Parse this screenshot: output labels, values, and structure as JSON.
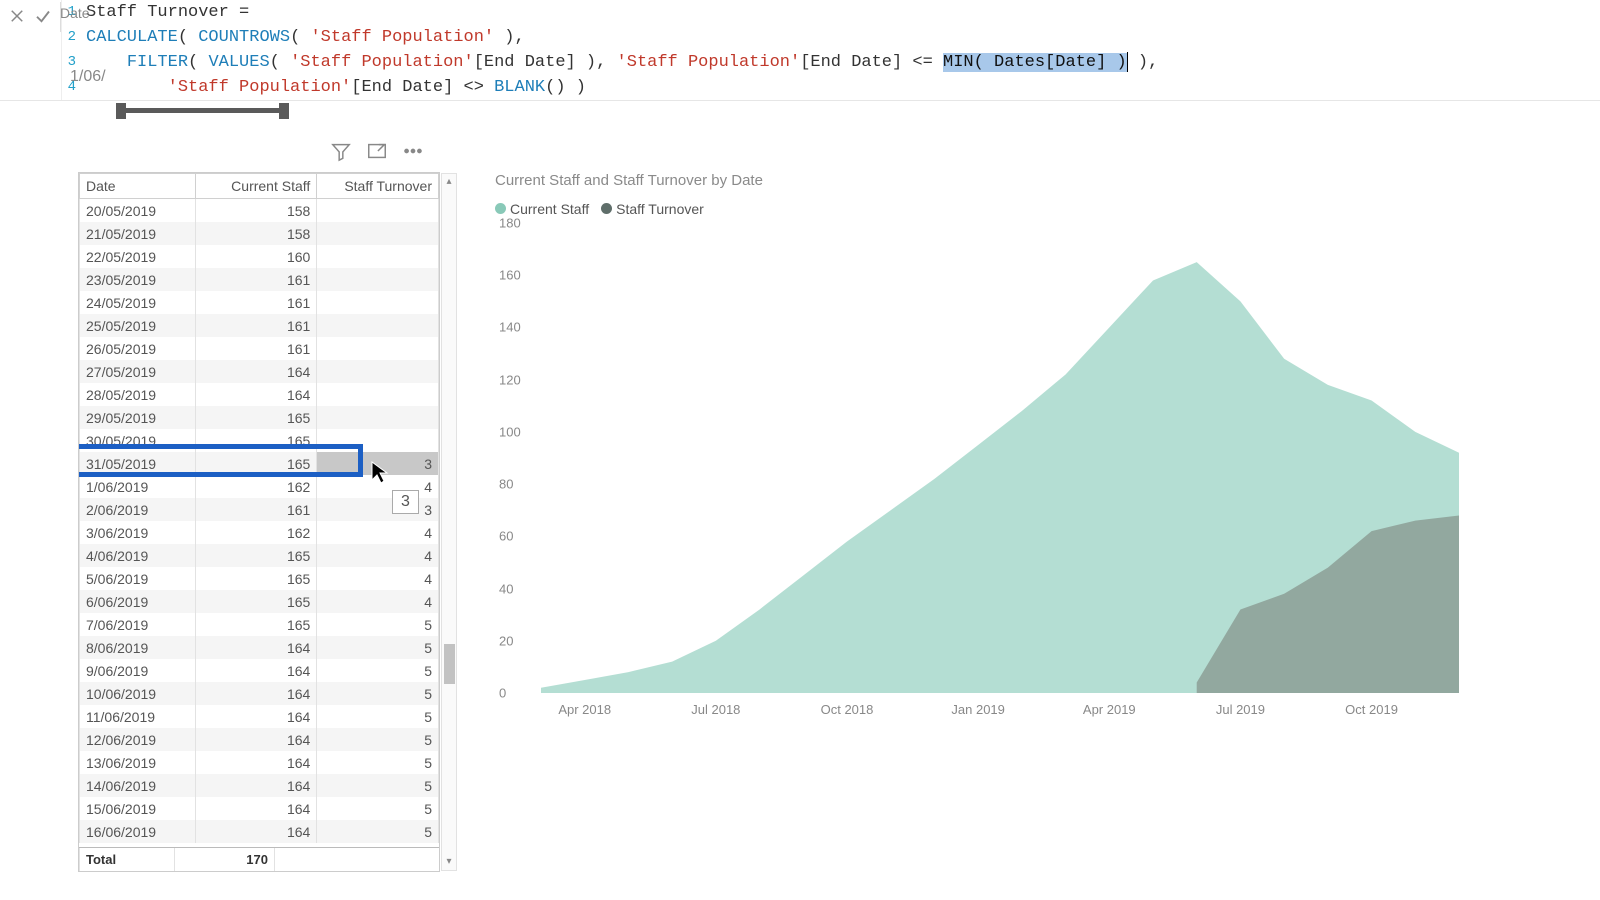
{
  "slicer": {
    "name_label": "Date",
    "value": "1/06/"
  },
  "formula": {
    "lines": [
      {
        "n": "1",
        "plain_a": "Staff Turnover ="
      },
      {
        "n": "2",
        "f1": "CALCULATE",
        "f2": "COUNTROWS",
        "s1": "'Staff Population'"
      },
      {
        "n": "3",
        "f1": "FILTER",
        "f2": "VALUES",
        "s1": "'Staff Population'",
        "col": "[End Date]",
        "s2": "'Staff Population'",
        "col2": "[End Date]",
        "op": "<=",
        "f3": "MIN",
        "arg": "Dates[Date]"
      },
      {
        "n": "4",
        "s1": "'Staff Population'",
        "col": "[End Date]",
        "op": "<>",
        "f1": "BLANK"
      }
    ]
  },
  "table": {
    "headers": [
      "Date",
      "Current Staff",
      "Staff Turnover"
    ],
    "rows": [
      {
        "d": "20/05/2019",
        "c": "158",
        "t": ""
      },
      {
        "d": "21/05/2019",
        "c": "158",
        "t": ""
      },
      {
        "d": "22/05/2019",
        "c": "160",
        "t": ""
      },
      {
        "d": "23/05/2019",
        "c": "161",
        "t": ""
      },
      {
        "d": "24/05/2019",
        "c": "161",
        "t": ""
      },
      {
        "d": "25/05/2019",
        "c": "161",
        "t": ""
      },
      {
        "d": "26/05/2019",
        "c": "161",
        "t": ""
      },
      {
        "d": "27/05/2019",
        "c": "164",
        "t": ""
      },
      {
        "d": "28/05/2019",
        "c": "164",
        "t": ""
      },
      {
        "d": "29/05/2019",
        "c": "165",
        "t": ""
      },
      {
        "d": "30/05/2019",
        "c": "165",
        "t": ""
      },
      {
        "d": "31/05/2019",
        "c": "165",
        "t": "3",
        "sel": true
      },
      {
        "d": "1/06/2019",
        "c": "162",
        "t": "4"
      },
      {
        "d": "2/06/2019",
        "c": "161",
        "t": "3"
      },
      {
        "d": "3/06/2019",
        "c": "162",
        "t": "4"
      },
      {
        "d": "4/06/2019",
        "c": "165",
        "t": "4"
      },
      {
        "d": "5/06/2019",
        "c": "165",
        "t": "4"
      },
      {
        "d": "6/06/2019",
        "c": "165",
        "t": "4"
      },
      {
        "d": "7/06/2019",
        "c": "165",
        "t": "5"
      },
      {
        "d": "8/06/2019",
        "c": "164",
        "t": "5"
      },
      {
        "d": "9/06/2019",
        "c": "164",
        "t": "5"
      },
      {
        "d": "10/06/2019",
        "c": "164",
        "t": "5"
      },
      {
        "d": "11/06/2019",
        "c": "164",
        "t": "5"
      },
      {
        "d": "12/06/2019",
        "c": "164",
        "t": "5"
      },
      {
        "d": "13/06/2019",
        "c": "164",
        "t": "5"
      },
      {
        "d": "14/06/2019",
        "c": "164",
        "t": "5"
      },
      {
        "d": "15/06/2019",
        "c": "164",
        "t": "5"
      },
      {
        "d": "16/06/2019",
        "c": "164",
        "t": "5"
      }
    ],
    "total_label": "Total",
    "total_value": "170",
    "tooltip": "3"
  },
  "chart_title": "Current Staff and Staff Turnover by Date",
  "legend": {
    "a": "Current Staff",
    "b": "Staff Turnover"
  },
  "chart_data": {
    "type": "area",
    "title": "Current Staff and Staff Turnover by Date",
    "xlabel": "",
    "ylabel": "",
    "ylim": [
      0,
      180
    ],
    "y_ticks": [
      0,
      20,
      40,
      60,
      80,
      100,
      120,
      140,
      160,
      180
    ],
    "x_ticks": [
      "Apr 2018",
      "Jul 2018",
      "Oct 2018",
      "Jan 2019",
      "Apr 2019",
      "Jul 2019",
      "Oct 2019"
    ],
    "series": [
      {
        "name": "Current Staff",
        "color": "#a7d8cb",
        "x": [
          "Mar 2018",
          "Apr 2018",
          "May 2018",
          "Jun 2018",
          "Jul 2018",
          "Aug 2018",
          "Sep 2018",
          "Oct 2018",
          "Nov 2018",
          "Dec 2018",
          "Jan 2019",
          "Feb 2019",
          "Mar 2019",
          "Apr 2019",
          "May 2019",
          "Jun 2019",
          "Jul 2019",
          "Aug 2019",
          "Sep 2019",
          "Oct 2019",
          "Nov 2019",
          "Dec 2019"
        ],
        "values": [
          2,
          5,
          8,
          12,
          20,
          32,
          45,
          58,
          70,
          82,
          95,
          108,
          122,
          140,
          158,
          165,
          150,
          128,
          118,
          112,
          100,
          92
        ]
      },
      {
        "name": "Staff Turnover",
        "color": "#8ea299",
        "x": [
          "Jun 2019",
          "Jul 2019",
          "Aug 2019",
          "Sep 2019",
          "Oct 2019",
          "Nov 2019",
          "Dec 2019"
        ],
        "values": [
          4,
          32,
          38,
          48,
          62,
          66,
          68
        ]
      }
    ]
  }
}
